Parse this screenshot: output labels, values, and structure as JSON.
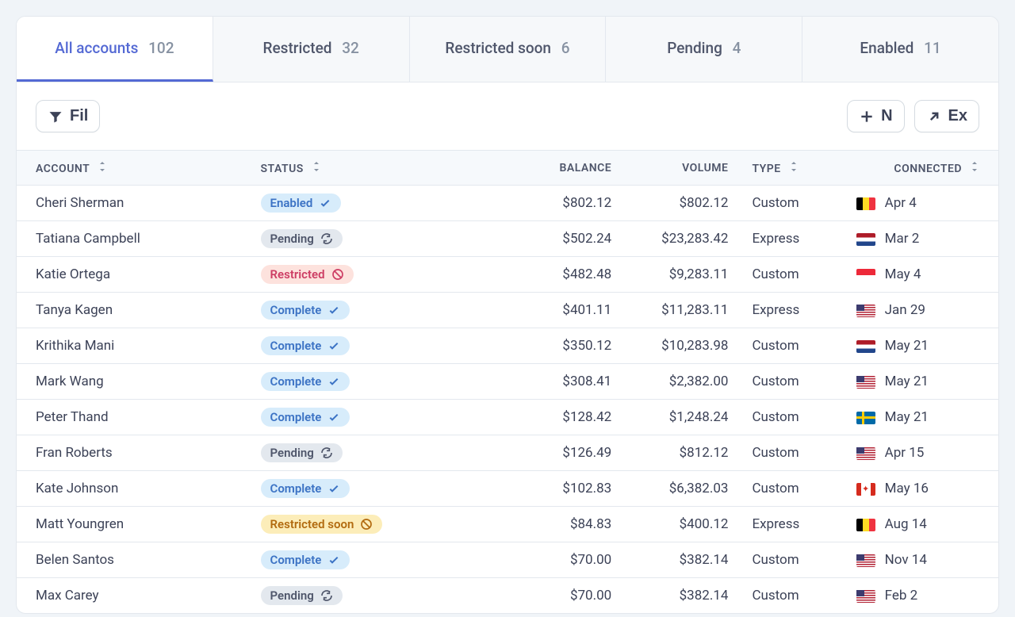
{
  "tabs": [
    {
      "label": "All accounts",
      "count": "102",
      "active": true
    },
    {
      "label": "Restricted",
      "count": "32",
      "active": false
    },
    {
      "label": "Restricted soon",
      "count": "6",
      "active": false
    },
    {
      "label": "Pending",
      "count": "4",
      "active": false
    },
    {
      "label": "Enabled",
      "count": "11",
      "active": false
    }
  ],
  "toolbar": {
    "filter_label": "Fil",
    "new_label": "N",
    "export_label": "Ex"
  },
  "columns": {
    "account": "ACCOUNT",
    "status": "STATUS",
    "balance": "BALANCE",
    "volume": "VOLUME",
    "type": "TYPE",
    "connected": "CONNECTED"
  },
  "status_labels": {
    "enabled": "Enabled",
    "pending": "Pending",
    "restricted": "Restricted",
    "complete": "Complete",
    "restricted_soon": "Restricted soon"
  },
  "rows": [
    {
      "account": "Cheri Sherman",
      "status": "enabled",
      "balance": "$802.12",
      "volume": "$802.12",
      "type": "Custom",
      "flag": "be",
      "connected": "Apr 4"
    },
    {
      "account": "Tatiana Campbell",
      "status": "pending",
      "balance": "$502.24",
      "volume": "$23,283.42",
      "type": "Express",
      "flag": "nl",
      "connected": "Mar 2"
    },
    {
      "account": "Katie Ortega",
      "status": "restricted",
      "balance": "$482.48",
      "volume": "$9,283.11",
      "type": "Custom",
      "flag": "sg",
      "connected": "May 4"
    },
    {
      "account": "Tanya Kagen",
      "status": "complete",
      "balance": "$401.11",
      "volume": "$11,283.11",
      "type": "Express",
      "flag": "us",
      "connected": "Jan 29"
    },
    {
      "account": "Krithika Mani",
      "status": "complete",
      "balance": "$350.12",
      "volume": "$10,283.98",
      "type": "Custom",
      "flag": "nl",
      "connected": "May 21"
    },
    {
      "account": "Mark Wang",
      "status": "complete",
      "balance": "$308.41",
      "volume": "$2,382.00",
      "type": "Custom",
      "flag": "us",
      "connected": "May 21"
    },
    {
      "account": "Peter Thand",
      "status": "complete",
      "balance": "$128.42",
      "volume": "$1,248.24",
      "type": "Custom",
      "flag": "se",
      "connected": "May 21"
    },
    {
      "account": "Fran Roberts",
      "status": "pending",
      "balance": "$126.49",
      "volume": "$812.12",
      "type": "Custom",
      "flag": "us",
      "connected": "Apr 15"
    },
    {
      "account": "Kate Johnson",
      "status": "complete",
      "balance": "$102.83",
      "volume": "$6,382.03",
      "type": "Custom",
      "flag": "ca",
      "connected": "May 16"
    },
    {
      "account": "Matt Youngren",
      "status": "restricted_soon",
      "balance": "$84.83",
      "volume": "$400.12",
      "type": "Express",
      "flag": "be",
      "connected": "Aug 14"
    },
    {
      "account": "Belen Santos",
      "status": "complete",
      "balance": "$70.00",
      "volume": "$382.14",
      "type": "Custom",
      "flag": "us",
      "connected": "Nov 14"
    },
    {
      "account": "Max Carey",
      "status": "pending",
      "balance": "$70.00",
      "volume": "$382.14",
      "type": "Custom",
      "flag": "us",
      "connected": "Feb 2"
    }
  ]
}
